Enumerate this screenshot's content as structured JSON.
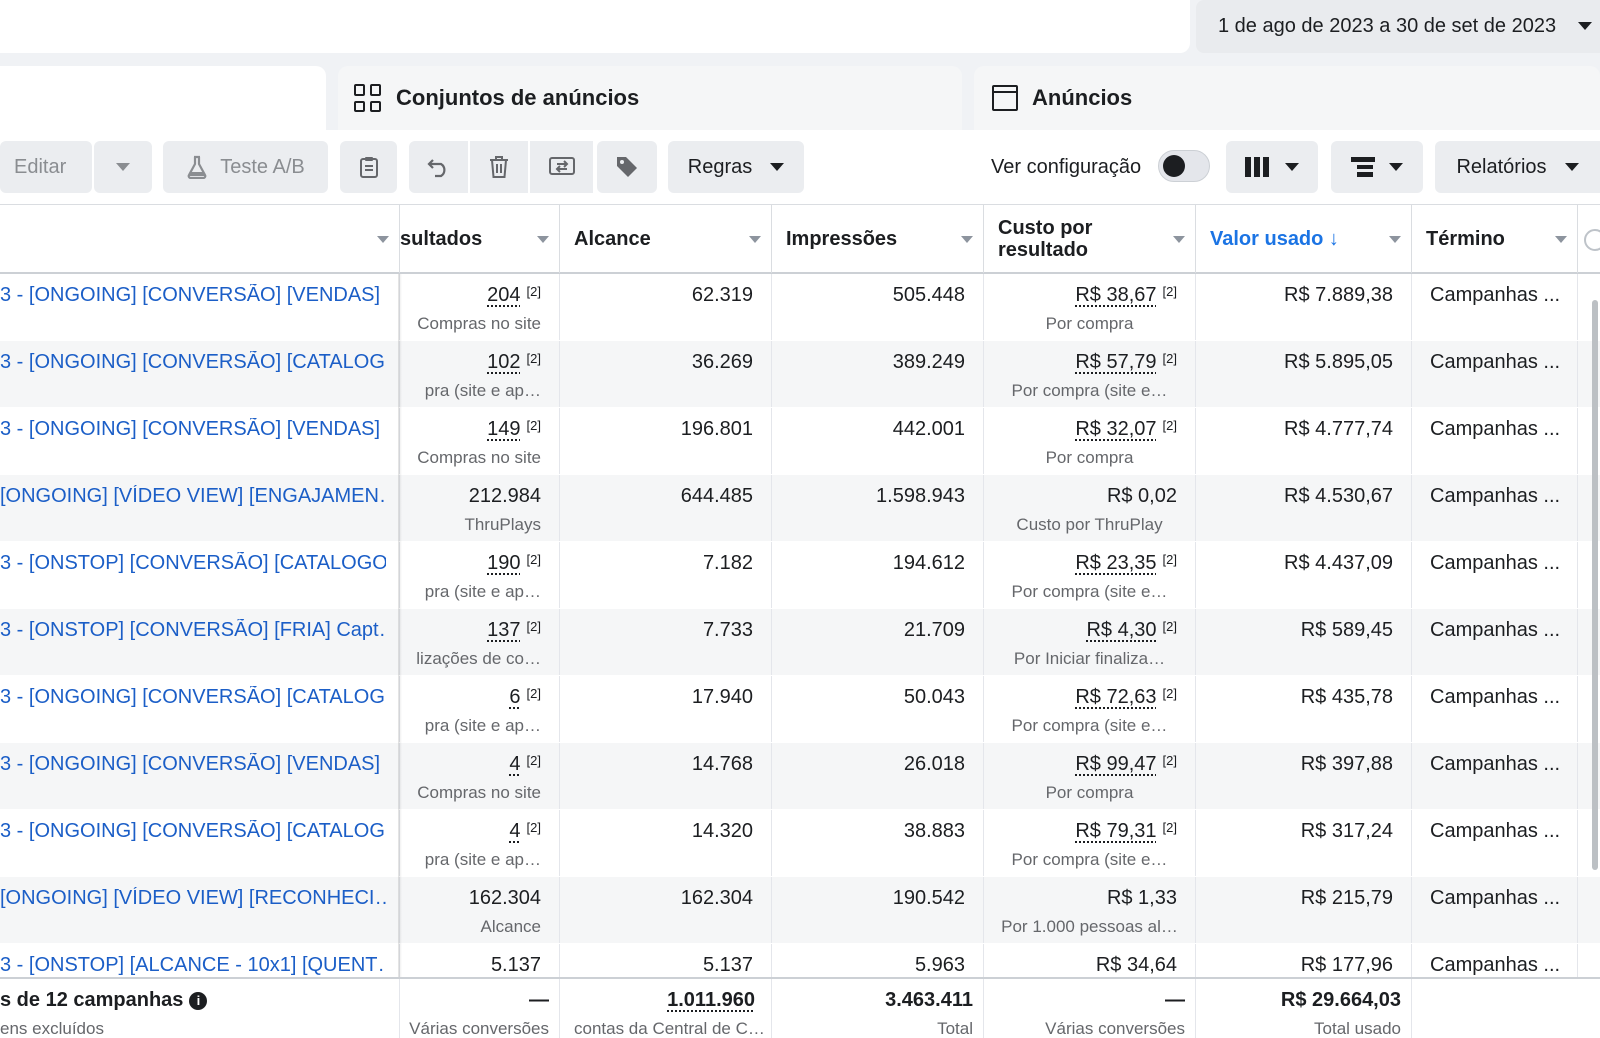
{
  "date_range": "1 de ago de 2023 a 30 de set de 2023",
  "tabs": {
    "adsets": "Conjuntos de anúncios",
    "ads": "Anúncios"
  },
  "toolbar": {
    "edit": "Editar",
    "ab_test": "Teste A/B",
    "rules": "Regras",
    "view_config": "Ver configuração",
    "reports": "Relatórios"
  },
  "columns": {
    "results": "sultados",
    "reach": "Alcance",
    "impressions": "Impressões",
    "cost_per_result": "Custo por resultado",
    "amount_spent": "Valor usado ↓",
    "end": "Término"
  },
  "rows": [
    {
      "name": "3 - [ONGOING] [CONVERSÃO] [VENDAS] …",
      "results": "204",
      "results_sup": "[2]",
      "results_sub": "Compras no site",
      "reach": "62.319",
      "impressions": "505.448",
      "cpr": "R$ 38,67",
      "cpr_sup": "[2]",
      "cpr_sub": "Por compra",
      "spent": "R$ 7.889,38",
      "end": "Campanhas ..."
    },
    {
      "name": "3 - [ONGOING] [CONVERSÃO] [CATALOG…",
      "results": "102",
      "results_sup": "[2]",
      "results_sub": "pra (site e ap…",
      "reach": "36.269",
      "impressions": "389.249",
      "cpr": "R$ 57,79",
      "cpr_sup": "[2]",
      "cpr_sub": "Por compra (site e…",
      "spent": "R$ 5.895,05",
      "end": "Campanhas ..."
    },
    {
      "name": "3 - [ONGOING] [CONVERSÃO] [VENDAS] …",
      "results": "149",
      "results_sup": "[2]",
      "results_sub": "Compras no site",
      "reach": "196.801",
      "impressions": "442.001",
      "cpr": "R$ 32,07",
      "cpr_sup": "[2]",
      "cpr_sub": "Por compra",
      "spent": "R$ 4.777,74",
      "end": "Campanhas ..."
    },
    {
      "name": "[ONGOING] [VÍDEO VIEW] [ENGAJAMEN…",
      "results": "212.984",
      "results_sup": "",
      "results_sub": "ThruPlays",
      "reach": "644.485",
      "impressions": "1.598.943",
      "cpr": "R$ 0,02",
      "cpr_sup": "",
      "cpr_sub": "Custo por ThruPlay",
      "spent": "R$ 4.530,67",
      "end": "Campanhas ..."
    },
    {
      "name": "3 - [ONSTOP] [CONVERSÃO] [CATALOGO…",
      "results": "190",
      "results_sup": "[2]",
      "results_sub": "pra (site e ap…",
      "reach": "7.182",
      "impressions": "194.612",
      "cpr": "R$ 23,35",
      "cpr_sup": "[2]",
      "cpr_sub": "Por compra (site e…",
      "spent": "R$ 4.437,09",
      "end": "Campanhas ..."
    },
    {
      "name": "3 - [ONSTOP] [CONVERSÃO] [FRIA] Capt…",
      "results": "137",
      "results_sup": "[2]",
      "results_sub": "lizações de co…",
      "reach": "7.733",
      "impressions": "21.709",
      "cpr": "R$ 4,30",
      "cpr_sup": "[2]",
      "cpr_sub": "Por Iniciar finaliza…",
      "spent": "R$ 589,45",
      "end": "Campanhas ..."
    },
    {
      "name": "3 - [ONGOING] [CONVERSÃO] [CATALOG…",
      "results": "6",
      "results_sup": "[2]",
      "results_sub": "pra (site e ap…",
      "reach": "17.940",
      "impressions": "50.043",
      "cpr": "R$ 72,63",
      "cpr_sup": "[2]",
      "cpr_sub": "Por compra (site e…",
      "spent": "R$ 435,78",
      "end": "Campanhas ..."
    },
    {
      "name": "3 - [ONGOING] [CONVERSÃO] [VENDAS] …",
      "results": "4",
      "results_sup": "[2]",
      "results_sub": "Compras no site",
      "reach": "14.768",
      "impressions": "26.018",
      "cpr": "R$ 99,47",
      "cpr_sup": "[2]",
      "cpr_sub": "Por compra",
      "spent": "R$ 397,88",
      "end": "Campanhas ..."
    },
    {
      "name": "3 - [ONGOING] [CONVERSÃO] [CATALOG…",
      "results": "4",
      "results_sup": "[2]",
      "results_sub": "pra (site e ap…",
      "reach": "14.320",
      "impressions": "38.883",
      "cpr": "R$ 79,31",
      "cpr_sup": "[2]",
      "cpr_sub": "Por compra (site e…",
      "spent": "R$ 317,24",
      "end": "Campanhas ..."
    },
    {
      "name": "[ONGOING] [VÍDEO VIEW] [RECONHECI…",
      "results": "162.304",
      "results_sup": "",
      "results_sub": "Alcance",
      "reach": "162.304",
      "impressions": "190.542",
      "cpr": "R$ 1,33",
      "cpr_sup": "",
      "cpr_sub": "Por 1.000 pessoas al…",
      "spent": "R$ 215,79",
      "end": "Campanhas ..."
    },
    {
      "name": "3 - [ONSTOP] [ALCANCE - 10x1] [QUENT…",
      "results": "5.137",
      "results_sup": "",
      "results_sub": "",
      "reach": "5.137",
      "impressions": "5.963",
      "cpr": "R$ 34,64",
      "cpr_sup": "",
      "cpr_sub": "",
      "spent": "R$ 177,96",
      "end": "Campanhas ..."
    }
  ],
  "footer": {
    "title": "s de 12 campanhas",
    "subtitle": "ens excluídos",
    "results": "—",
    "results_sub": "Várias conversões",
    "reach": "1.011.960",
    "reach_sub": "contas da Central de C…",
    "impressions": "3.463.411",
    "impressions_sub": "Total",
    "cpr": "—",
    "cpr_sub": "Várias conversões",
    "spent": "R$ 29.664,03",
    "spent_sub": "Total usado"
  }
}
